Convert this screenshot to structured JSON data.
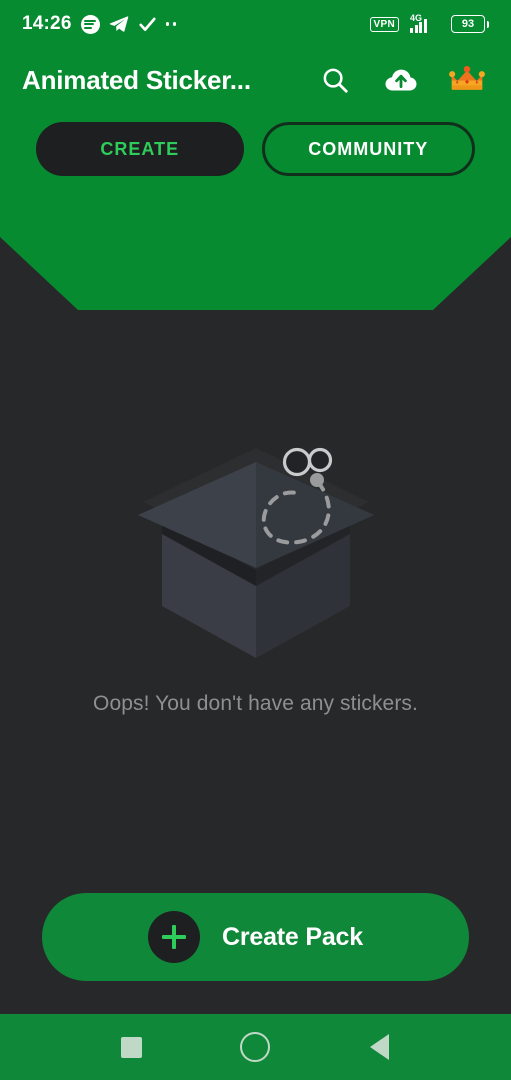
{
  "status_bar": {
    "time": "14:26",
    "left_icons": [
      "spotify-icon",
      "telegram-icon",
      "check-icon",
      "more-dots-icon"
    ],
    "vpn_label": "VPN",
    "network_type": "4G",
    "battery_level": "93",
    "signal_icon": "signal-bars-icon",
    "battery_icon": "battery-icon"
  },
  "app_bar": {
    "title": "Animated Sticker...",
    "actions": [
      {
        "name": "search-icon",
        "label": "Search"
      },
      {
        "name": "cloud-upload-icon",
        "label": "Upload"
      },
      {
        "name": "crown-icon",
        "label": "Premium"
      }
    ]
  },
  "tabs": [
    {
      "label": "CREATE",
      "active": true
    },
    {
      "label": "COMMUNITY",
      "active": false
    }
  ],
  "empty_state": {
    "message": "Oops! You don't have any stickers.",
    "illustration": "empty-box-with-fly-illustration"
  },
  "cta": {
    "label": "Create Pack",
    "icon": "plus-icon"
  },
  "nav_bar": {
    "buttons": [
      {
        "name": "recents-button",
        "icon": "square-icon"
      },
      {
        "name": "home-button",
        "icon": "circle-icon"
      },
      {
        "name": "back-button",
        "icon": "triangle-left-icon"
      }
    ]
  },
  "colors": {
    "header_green": "#078B31",
    "background_dark": "#272829",
    "accent_green": "#2ECC5B",
    "button_green": "#10883A",
    "tab_active_bg": "#1E1F20",
    "muted_text": "#8E8F91",
    "nav_icon": "#BFD9C6"
  }
}
